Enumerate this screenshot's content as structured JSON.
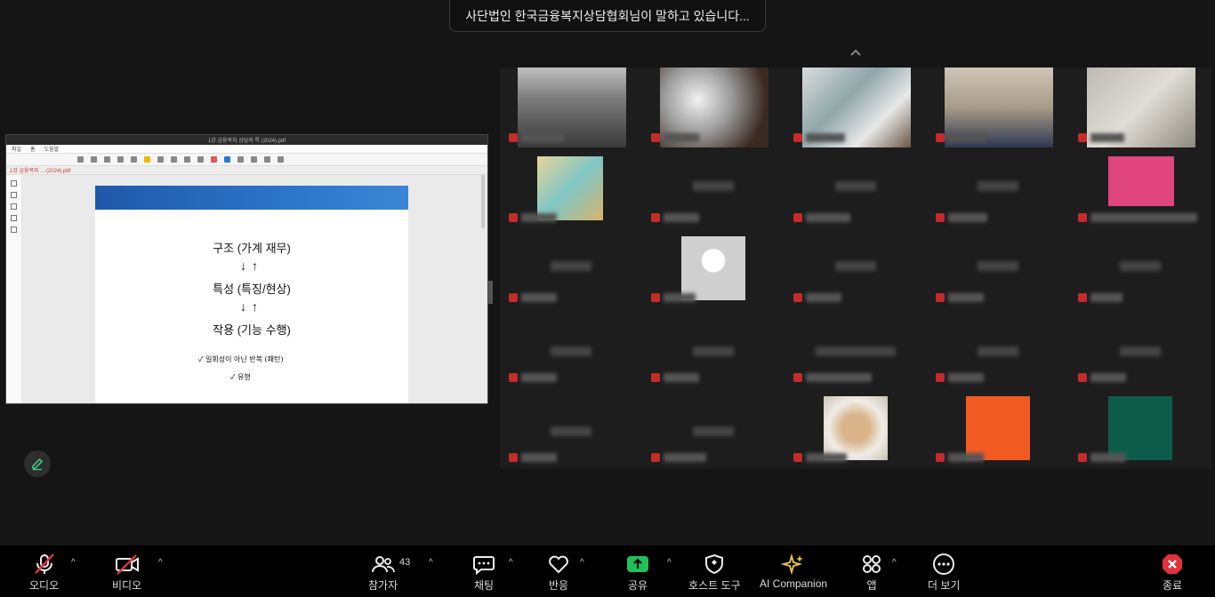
{
  "speaking_banner": "사단법인 한국금융복지상담협회님이 말하고 있습니다...",
  "pdf": {
    "window_title": "1강 금융복지 상담의 특 (2024).pdf",
    "menu": [
      "파일",
      "홈",
      "도움말",
      "",
      "",
      "",
      "",
      "",
      "",
      "",
      "",
      "",
      "",
      "",
      ""
    ],
    "tab": "1강 금융복지 ... (2024).pdf",
    "lines": [
      "구조 (가계 재무)",
      "특성 (특징/현상)",
      "작용 (기능 수행)"
    ],
    "arrows": "↓↑",
    "bullets": [
      "✓ 일회성이 아닌 반복 (패턴)",
      "✓ 유형"
    ]
  },
  "toolbar": {
    "audio": "오디오",
    "video": "비디오",
    "participants": "참가자",
    "participants_count": "43",
    "chat": "채팅",
    "react": "반응",
    "share": "공유",
    "host_tools": "호스트 도구",
    "ai": "AI Companion",
    "apps": "앱",
    "more": "더 보기",
    "end": "종료"
  },
  "colors": {
    "share_green": "#1fc15a",
    "end_red": "#e0323b",
    "mute_red": "#e0323b",
    "ai_gold": "#f5c842"
  }
}
